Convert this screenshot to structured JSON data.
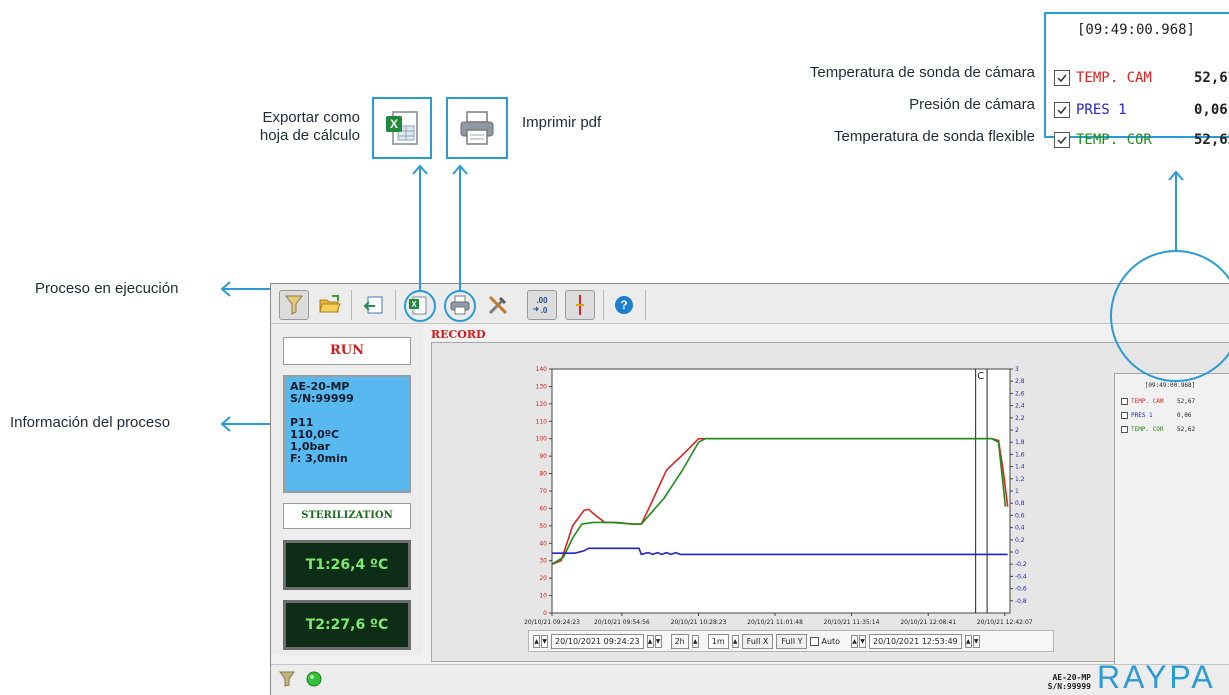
{
  "callouts": {
    "export": [
      "Exportar como",
      "hoja de cálculo"
    ],
    "print": "Imprimir pdf",
    "run_process": "Proceso en ejecución",
    "process_info": "Información del proceso",
    "probe_cam": "Temperatura de sonda de cámara",
    "pressure": "Presión de cámara",
    "probe_flex": "Temperatura de sonda flexible"
  },
  "legend": {
    "timestamp": "[09:49:00.968]",
    "items": [
      {
        "label": "TEMP. CAM",
        "value": "52,67",
        "color": "#e02020",
        "checked": true
      },
      {
        "label": "PRES 1",
        "value": "0,06",
        "color": "#2323c8",
        "checked": true
      },
      {
        "label": "TEMP. COR",
        "value": "52,62",
        "color": "#1a8f1a",
        "checked": true
      }
    ]
  },
  "toolbar": {
    "buttons": [
      "filter-icon",
      "open-folder-icon",
      "export-back-icon",
      "excel-export-icon",
      "print-icon",
      "tools-icon",
      "decimal-icon",
      "cursor-line-icon",
      "help-icon"
    ]
  },
  "process": {
    "status": "RUN",
    "info_lines": [
      "AE-20-MP",
      "S/N:99999",
      "",
      "P11",
      "110,0ºC",
      "1,0bar",
      "F: 3,0min"
    ],
    "phase": "STERILIZATION",
    "t1": "T1:26,4 ºC",
    "t2": "T2:27,6 ºC"
  },
  "chart": {
    "label": "RECORD",
    "cursor_label": "C"
  },
  "chart_data": {
    "type": "line",
    "x_ticks": [
      "20/10/21 09:24:23",
      "20/10/21 09:54:56",
      "20/10/21 10:28:23",
      "20/10/21 11:01:48",
      "20/10/21 11:35:14",
      "20/10/21 12:08:41",
      "20/10/21 12:42:07"
    ],
    "y_left_ticks": [
      "0",
      "10",
      "20",
      "30",
      "40",
      "50",
      "60",
      "70",
      "80",
      "90",
      "100",
      "110",
      "120",
      "130",
      "140"
    ],
    "y_right_ticks": [
      "-0,8",
      "-0,6",
      "-0,4",
      "-0,2",
      "0",
      "0,2",
      "0,4",
      "0,6",
      "0,8",
      "1",
      "1,2",
      "1,4",
      "1,6",
      "1,8",
      "2",
      "2,2",
      "2,4",
      "2,6",
      "2,8",
      "3"
    ],
    "ylim_left": [
      0,
      140
    ],
    "ylim_right": [
      -1,
      3
    ],
    "x_minutes_from_0924": [
      0,
      30.5,
      64,
      97.4,
      130.8,
      164.3,
      197.7
    ],
    "series": [
      {
        "name": "TEMP. CAM",
        "axis": "left",
        "color": "#e02020",
        "points": [
          [
            0,
            28
          ],
          [
            4,
            30
          ],
          [
            9,
            50
          ],
          [
            14,
            59
          ],
          [
            16,
            59.5
          ],
          [
            19,
            56
          ],
          [
            23,
            52
          ],
          [
            28,
            52
          ],
          [
            35,
            51
          ],
          [
            39,
            51
          ],
          [
            43,
            62
          ],
          [
            50,
            82
          ],
          [
            58,
            92
          ],
          [
            64,
            100
          ],
          [
            100,
            100
          ],
          [
            150,
            100
          ],
          [
            192,
            100
          ],
          [
            195,
            99
          ],
          [
            197,
            82
          ],
          [
            199,
            61
          ]
        ]
      },
      {
        "name": "TEMP. COR",
        "axis": "left",
        "color": "#1a8f1a",
        "points": [
          [
            0,
            28
          ],
          [
            5,
            32
          ],
          [
            9,
            43
          ],
          [
            13,
            51
          ],
          [
            18,
            52
          ],
          [
            26,
            52
          ],
          [
            35,
            51
          ],
          [
            39,
            51
          ],
          [
            43,
            57
          ],
          [
            49,
            66
          ],
          [
            57,
            82
          ],
          [
            64,
            98
          ],
          [
            67,
            100
          ],
          [
            100,
            100
          ],
          [
            150,
            100
          ],
          [
            192,
            100
          ],
          [
            195,
            98
          ],
          [
            198,
            61
          ]
        ]
      },
      {
        "name": "PRES 1",
        "axis": "right",
        "color": "#2323c8",
        "points": [
          [
            0,
            -0.02
          ],
          [
            10,
            -0.02
          ],
          [
            14,
            0.02
          ],
          [
            16,
            0.06
          ],
          [
            18,
            0.06
          ],
          [
            38,
            0.06
          ],
          [
            39,
            -0.04
          ],
          [
            42,
            -0.01
          ],
          [
            44,
            -0.04
          ],
          [
            46,
            -0.01
          ],
          [
            48,
            -0.04
          ],
          [
            50,
            -0.01
          ],
          [
            52,
            -0.04
          ],
          [
            54,
            -0.01
          ],
          [
            56,
            -0.04
          ],
          [
            60,
            -0.04
          ],
          [
            100,
            -0.04
          ],
          [
            150,
            -0.04
          ],
          [
            199,
            -0.04
          ]
        ]
      }
    ]
  },
  "controls": {
    "start_datetime": "20/10/2021 09:24:23",
    "span_hours": "2h",
    "span_minutes": "1m",
    "full_x": "Full X",
    "full_y": "Full Y",
    "auto": "Auto",
    "end_datetime": "20/10/2021 12:53:49"
  },
  "footer": {
    "device_name": "AE-20-MP",
    "serial": "S/N:99999",
    "brand": "RAYPA"
  }
}
